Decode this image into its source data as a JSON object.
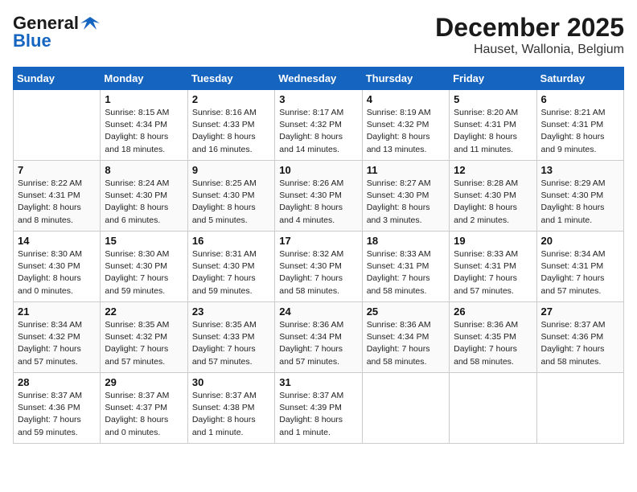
{
  "header": {
    "logo_line1": "General",
    "logo_line2": "Blue",
    "month": "December 2025",
    "location": "Hauset, Wallonia, Belgium"
  },
  "weekdays": [
    "Sunday",
    "Monday",
    "Tuesday",
    "Wednesday",
    "Thursday",
    "Friday",
    "Saturday"
  ],
  "weeks": [
    [
      {
        "day": "",
        "info": ""
      },
      {
        "day": "1",
        "info": "Sunrise: 8:15 AM\nSunset: 4:34 PM\nDaylight: 8 hours\nand 18 minutes."
      },
      {
        "day": "2",
        "info": "Sunrise: 8:16 AM\nSunset: 4:33 PM\nDaylight: 8 hours\nand 16 minutes."
      },
      {
        "day": "3",
        "info": "Sunrise: 8:17 AM\nSunset: 4:32 PM\nDaylight: 8 hours\nand 14 minutes."
      },
      {
        "day": "4",
        "info": "Sunrise: 8:19 AM\nSunset: 4:32 PM\nDaylight: 8 hours\nand 13 minutes."
      },
      {
        "day": "5",
        "info": "Sunrise: 8:20 AM\nSunset: 4:31 PM\nDaylight: 8 hours\nand 11 minutes."
      },
      {
        "day": "6",
        "info": "Sunrise: 8:21 AM\nSunset: 4:31 PM\nDaylight: 8 hours\nand 9 minutes."
      }
    ],
    [
      {
        "day": "7",
        "info": "Sunrise: 8:22 AM\nSunset: 4:31 PM\nDaylight: 8 hours\nand 8 minutes."
      },
      {
        "day": "8",
        "info": "Sunrise: 8:24 AM\nSunset: 4:30 PM\nDaylight: 8 hours\nand 6 minutes."
      },
      {
        "day": "9",
        "info": "Sunrise: 8:25 AM\nSunset: 4:30 PM\nDaylight: 8 hours\nand 5 minutes."
      },
      {
        "day": "10",
        "info": "Sunrise: 8:26 AM\nSunset: 4:30 PM\nDaylight: 8 hours\nand 4 minutes."
      },
      {
        "day": "11",
        "info": "Sunrise: 8:27 AM\nSunset: 4:30 PM\nDaylight: 8 hours\nand 3 minutes."
      },
      {
        "day": "12",
        "info": "Sunrise: 8:28 AM\nSunset: 4:30 PM\nDaylight: 8 hours\nand 2 minutes."
      },
      {
        "day": "13",
        "info": "Sunrise: 8:29 AM\nSunset: 4:30 PM\nDaylight: 8 hours\nand 1 minute."
      }
    ],
    [
      {
        "day": "14",
        "info": "Sunrise: 8:30 AM\nSunset: 4:30 PM\nDaylight: 8 hours\nand 0 minutes."
      },
      {
        "day": "15",
        "info": "Sunrise: 8:30 AM\nSunset: 4:30 PM\nDaylight: 7 hours\nand 59 minutes."
      },
      {
        "day": "16",
        "info": "Sunrise: 8:31 AM\nSunset: 4:30 PM\nDaylight: 7 hours\nand 59 minutes."
      },
      {
        "day": "17",
        "info": "Sunrise: 8:32 AM\nSunset: 4:30 PM\nDaylight: 7 hours\nand 58 minutes."
      },
      {
        "day": "18",
        "info": "Sunrise: 8:33 AM\nSunset: 4:31 PM\nDaylight: 7 hours\nand 58 minutes."
      },
      {
        "day": "19",
        "info": "Sunrise: 8:33 AM\nSunset: 4:31 PM\nDaylight: 7 hours\nand 57 minutes."
      },
      {
        "day": "20",
        "info": "Sunrise: 8:34 AM\nSunset: 4:31 PM\nDaylight: 7 hours\nand 57 minutes."
      }
    ],
    [
      {
        "day": "21",
        "info": "Sunrise: 8:34 AM\nSunset: 4:32 PM\nDaylight: 7 hours\nand 57 minutes."
      },
      {
        "day": "22",
        "info": "Sunrise: 8:35 AM\nSunset: 4:32 PM\nDaylight: 7 hours\nand 57 minutes."
      },
      {
        "day": "23",
        "info": "Sunrise: 8:35 AM\nSunset: 4:33 PM\nDaylight: 7 hours\nand 57 minutes."
      },
      {
        "day": "24",
        "info": "Sunrise: 8:36 AM\nSunset: 4:34 PM\nDaylight: 7 hours\nand 57 minutes."
      },
      {
        "day": "25",
        "info": "Sunrise: 8:36 AM\nSunset: 4:34 PM\nDaylight: 7 hours\nand 58 minutes."
      },
      {
        "day": "26",
        "info": "Sunrise: 8:36 AM\nSunset: 4:35 PM\nDaylight: 7 hours\nand 58 minutes."
      },
      {
        "day": "27",
        "info": "Sunrise: 8:37 AM\nSunset: 4:36 PM\nDaylight: 7 hours\nand 58 minutes."
      }
    ],
    [
      {
        "day": "28",
        "info": "Sunrise: 8:37 AM\nSunset: 4:36 PM\nDaylight: 7 hours\nand 59 minutes."
      },
      {
        "day": "29",
        "info": "Sunrise: 8:37 AM\nSunset: 4:37 PM\nDaylight: 8 hours\nand 0 minutes."
      },
      {
        "day": "30",
        "info": "Sunrise: 8:37 AM\nSunset: 4:38 PM\nDaylight: 8 hours\nand 1 minute."
      },
      {
        "day": "31",
        "info": "Sunrise: 8:37 AM\nSunset: 4:39 PM\nDaylight: 8 hours\nand 1 minute."
      },
      {
        "day": "",
        "info": ""
      },
      {
        "day": "",
        "info": ""
      },
      {
        "day": "",
        "info": ""
      }
    ]
  ]
}
